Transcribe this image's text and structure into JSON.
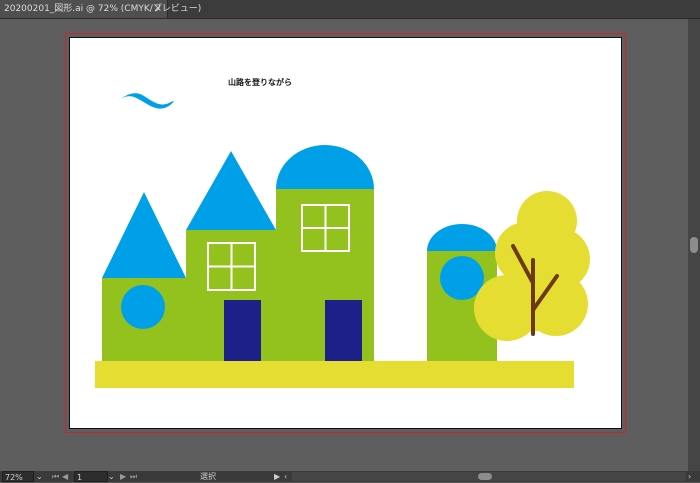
{
  "window": {
    "tab_title": "20200201_図形.ai @ 72% (CMYK/プレビュー)",
    "tab_close": "×"
  },
  "artwork": {
    "title": "山路を登りながら",
    "colors": {
      "green": "#93c21f",
      "sky_blue": "#00a0e9",
      "navy": "#1d2088",
      "yellow": "#e6dd32",
      "trunk": "#6b3a12",
      "white": "#ffffff"
    }
  },
  "statusbar": {
    "zoom": "72%",
    "zoom_dropdown": "⌄",
    "first": "⏮",
    "prev": "◀",
    "artboard_number": "1",
    "artboard_dropdown": "⌄",
    "next": "▶",
    "last": "⏭",
    "tool_name": "選択",
    "play": "▶",
    "scroll_left": "‹",
    "scroll_right": "›"
  }
}
